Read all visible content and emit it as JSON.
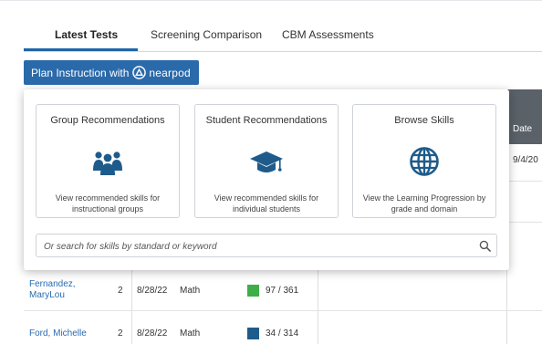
{
  "tabs": [
    {
      "label": "Latest Tests",
      "active": true
    },
    {
      "label": "Screening Comparison",
      "active": false
    },
    {
      "label": "CBM Assessments",
      "active": false
    }
  ],
  "plan_button": {
    "label": "Plan Instruction with",
    "brand": "nearpod"
  },
  "popup": {
    "cards": [
      {
        "title": "Group Recommendations",
        "icon": "group-users-icon",
        "description": "View recommended skills for instructional groups"
      },
      {
        "title": "Student Recommendations",
        "icon": "graduation-cap-icon",
        "description": "View recommended skills for individual students"
      },
      {
        "title": "Browse Skills",
        "icon": "globe-icon",
        "description": "View the Learning Progression by grade and domain"
      }
    ],
    "search": {
      "placeholder": "Or search for skills by standard or keyword",
      "icon": "search-icon"
    }
  },
  "table": {
    "date_header": "Date",
    "date_cell": "9/4/20",
    "rows": [
      {
        "name": "Fernandez, MaryLou",
        "grade": "2",
        "date": "8/28/22",
        "subject": "Math",
        "score": "97 / 361",
        "score_color": "#3fae49"
      },
      {
        "name": "Ford, Michelle",
        "grade": "2",
        "date": "8/28/22",
        "subject": "Math",
        "score": "34 / 314",
        "score_color": "#1f5b8a"
      }
    ]
  },
  "colors": {
    "accent": "#2b6aaa",
    "icon_blue": "#1f5b8a"
  }
}
